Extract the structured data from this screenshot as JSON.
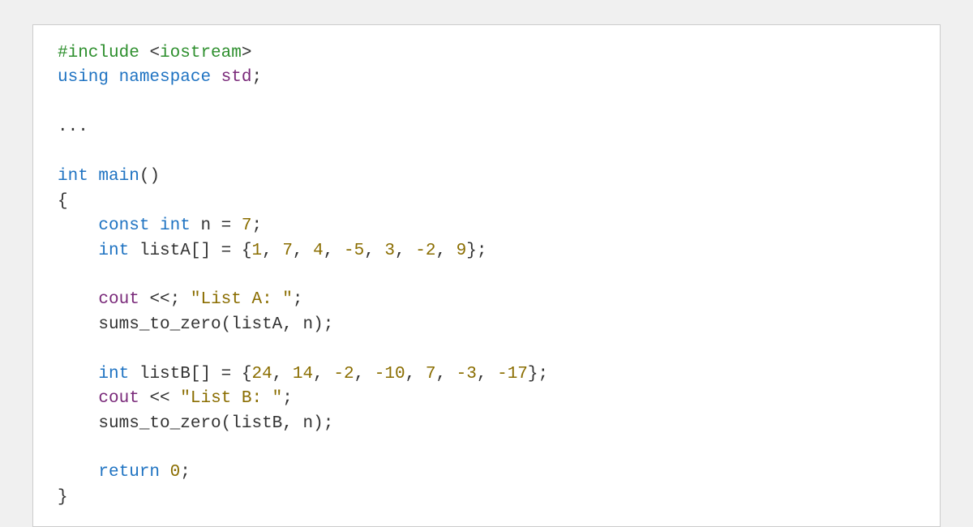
{
  "code": {
    "line1": {
      "include": "#include",
      "lt": "<",
      "hdr": "iostream",
      "gt": ">"
    },
    "line2": {
      "using": "using",
      "namespace": "namespace",
      "std": "std",
      "semi": ";"
    },
    "line3": {
      "ellipsis": "..."
    },
    "line4": {
      "int": "int",
      "main": "main",
      "paren": "()"
    },
    "line5": {
      "open": "{"
    },
    "line6": {
      "indent": "    ",
      "const": "const",
      "int": "int",
      "var": "n",
      "eq": " = ",
      "val": "7",
      "semi": ";"
    },
    "line7": {
      "indent": "    ",
      "int": "int",
      "var": "listA[]",
      "eq": " = ",
      "open": "{",
      "v1": "1",
      "c1": ", ",
      "v2": "7",
      "c2": ", ",
      "v3": "4",
      "c3": ", ",
      "v4": "-5",
      "c4": ", ",
      "v5": "3",
      "c5": ", ",
      "v6": "-2",
      "c6": ", ",
      "v7": "9",
      "close": "}",
      "semi": ";"
    },
    "line8": {
      "indent": "    ",
      "cout": "cout",
      "op": " <<; ",
      "str": "\"List A: \"",
      "semi": ";"
    },
    "line9": {
      "indent": "    ",
      "fn": "sums_to_zero",
      "open": "(",
      "arg1": "listA",
      "c": ", ",
      "arg2": "n",
      "close": ")",
      "semi": ";"
    },
    "line10": {
      "indent": "    ",
      "int": "int",
      "var": "listB[]",
      "eq": " = ",
      "open": "{",
      "v1": "24",
      "c1": ", ",
      "v2": "14",
      "c2": ", ",
      "v3": "-2",
      "c3": ", ",
      "v4": "-10",
      "c4": ", ",
      "v5": "7",
      "c5": ", ",
      "v6": "-3",
      "c6": ", ",
      "v7": "-17",
      "close": "}",
      "semi": ";"
    },
    "line11": {
      "indent": "    ",
      "cout": "cout",
      "op": " << ",
      "str": "\"List B: \"",
      "semi": ";"
    },
    "line12": {
      "indent": "    ",
      "fn": "sums_to_zero",
      "open": "(",
      "arg1": "listB",
      "c": ", ",
      "arg2": "n",
      "close": ")",
      "semi": ";"
    },
    "line13": {
      "indent": "    ",
      "return": "return",
      "sp": " ",
      "val": "0",
      "semi": ";"
    },
    "line14": {
      "close": "}"
    }
  }
}
